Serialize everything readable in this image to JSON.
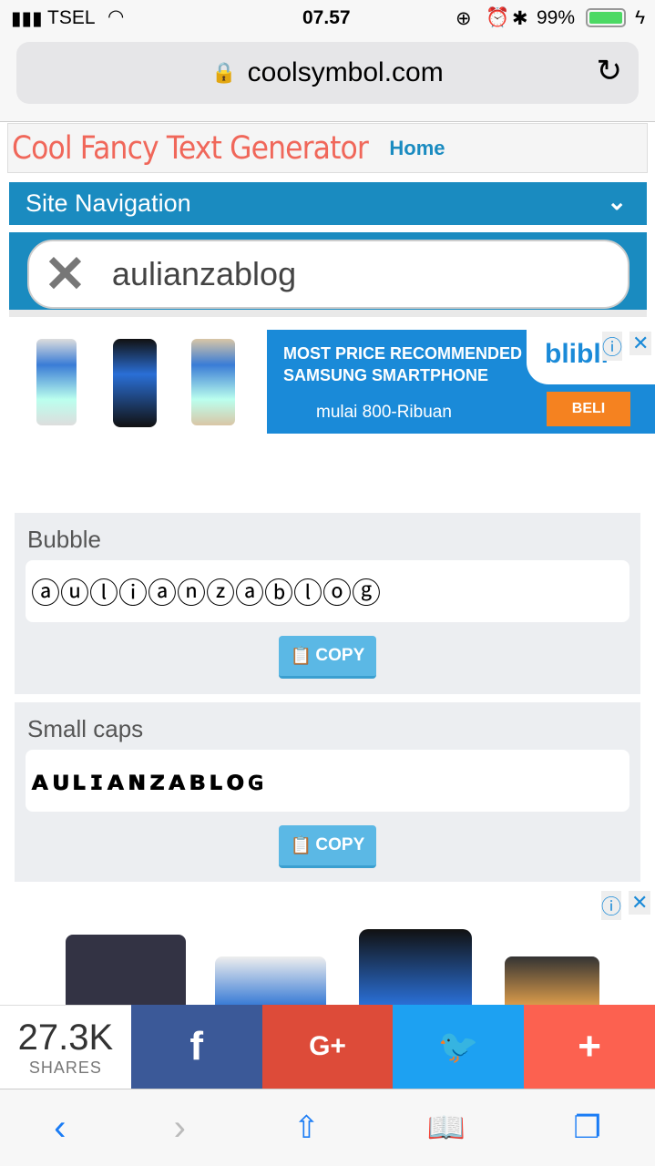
{
  "status": {
    "carrier": "TSEL",
    "time": "07.57",
    "battery": "99%"
  },
  "browser": {
    "url": "coolsymbol.com"
  },
  "site": {
    "title": "Cool Fancy Text Generator",
    "home": "Home",
    "nav": "Site Navigation",
    "input_value": "aulianzablog"
  },
  "ad1": {
    "line1": "MOST PRICE RECOMMENDED",
    "line2": "SAMSUNG SMARTPHONE",
    "line3": "mulai 800-Ribuan",
    "brand": "blibli",
    "cta": "BELI"
  },
  "results": [
    {
      "label": "Bubble",
      "text": "ⓐⓤⓛⓘⓐⓝⓩⓐⓑⓛⓞⓖ",
      "copy": "COPY"
    },
    {
      "label": "Small caps",
      "text": "ᴀᴜʟɪᴀɴᴢᴀʙʟᴏɢ",
      "copy": "COPY"
    }
  ],
  "shares": {
    "count": "27.3K",
    "label": "SHARES",
    "facebook": "f",
    "google": "G+",
    "twitter": "🐦",
    "more": "+"
  },
  "colors": {
    "accent": "#1a8bc0",
    "title": "#f0675a",
    "facebook": "#3b5998",
    "google": "#dd4b39",
    "twitter": "#1da1f2",
    "more": "#fc6150"
  }
}
